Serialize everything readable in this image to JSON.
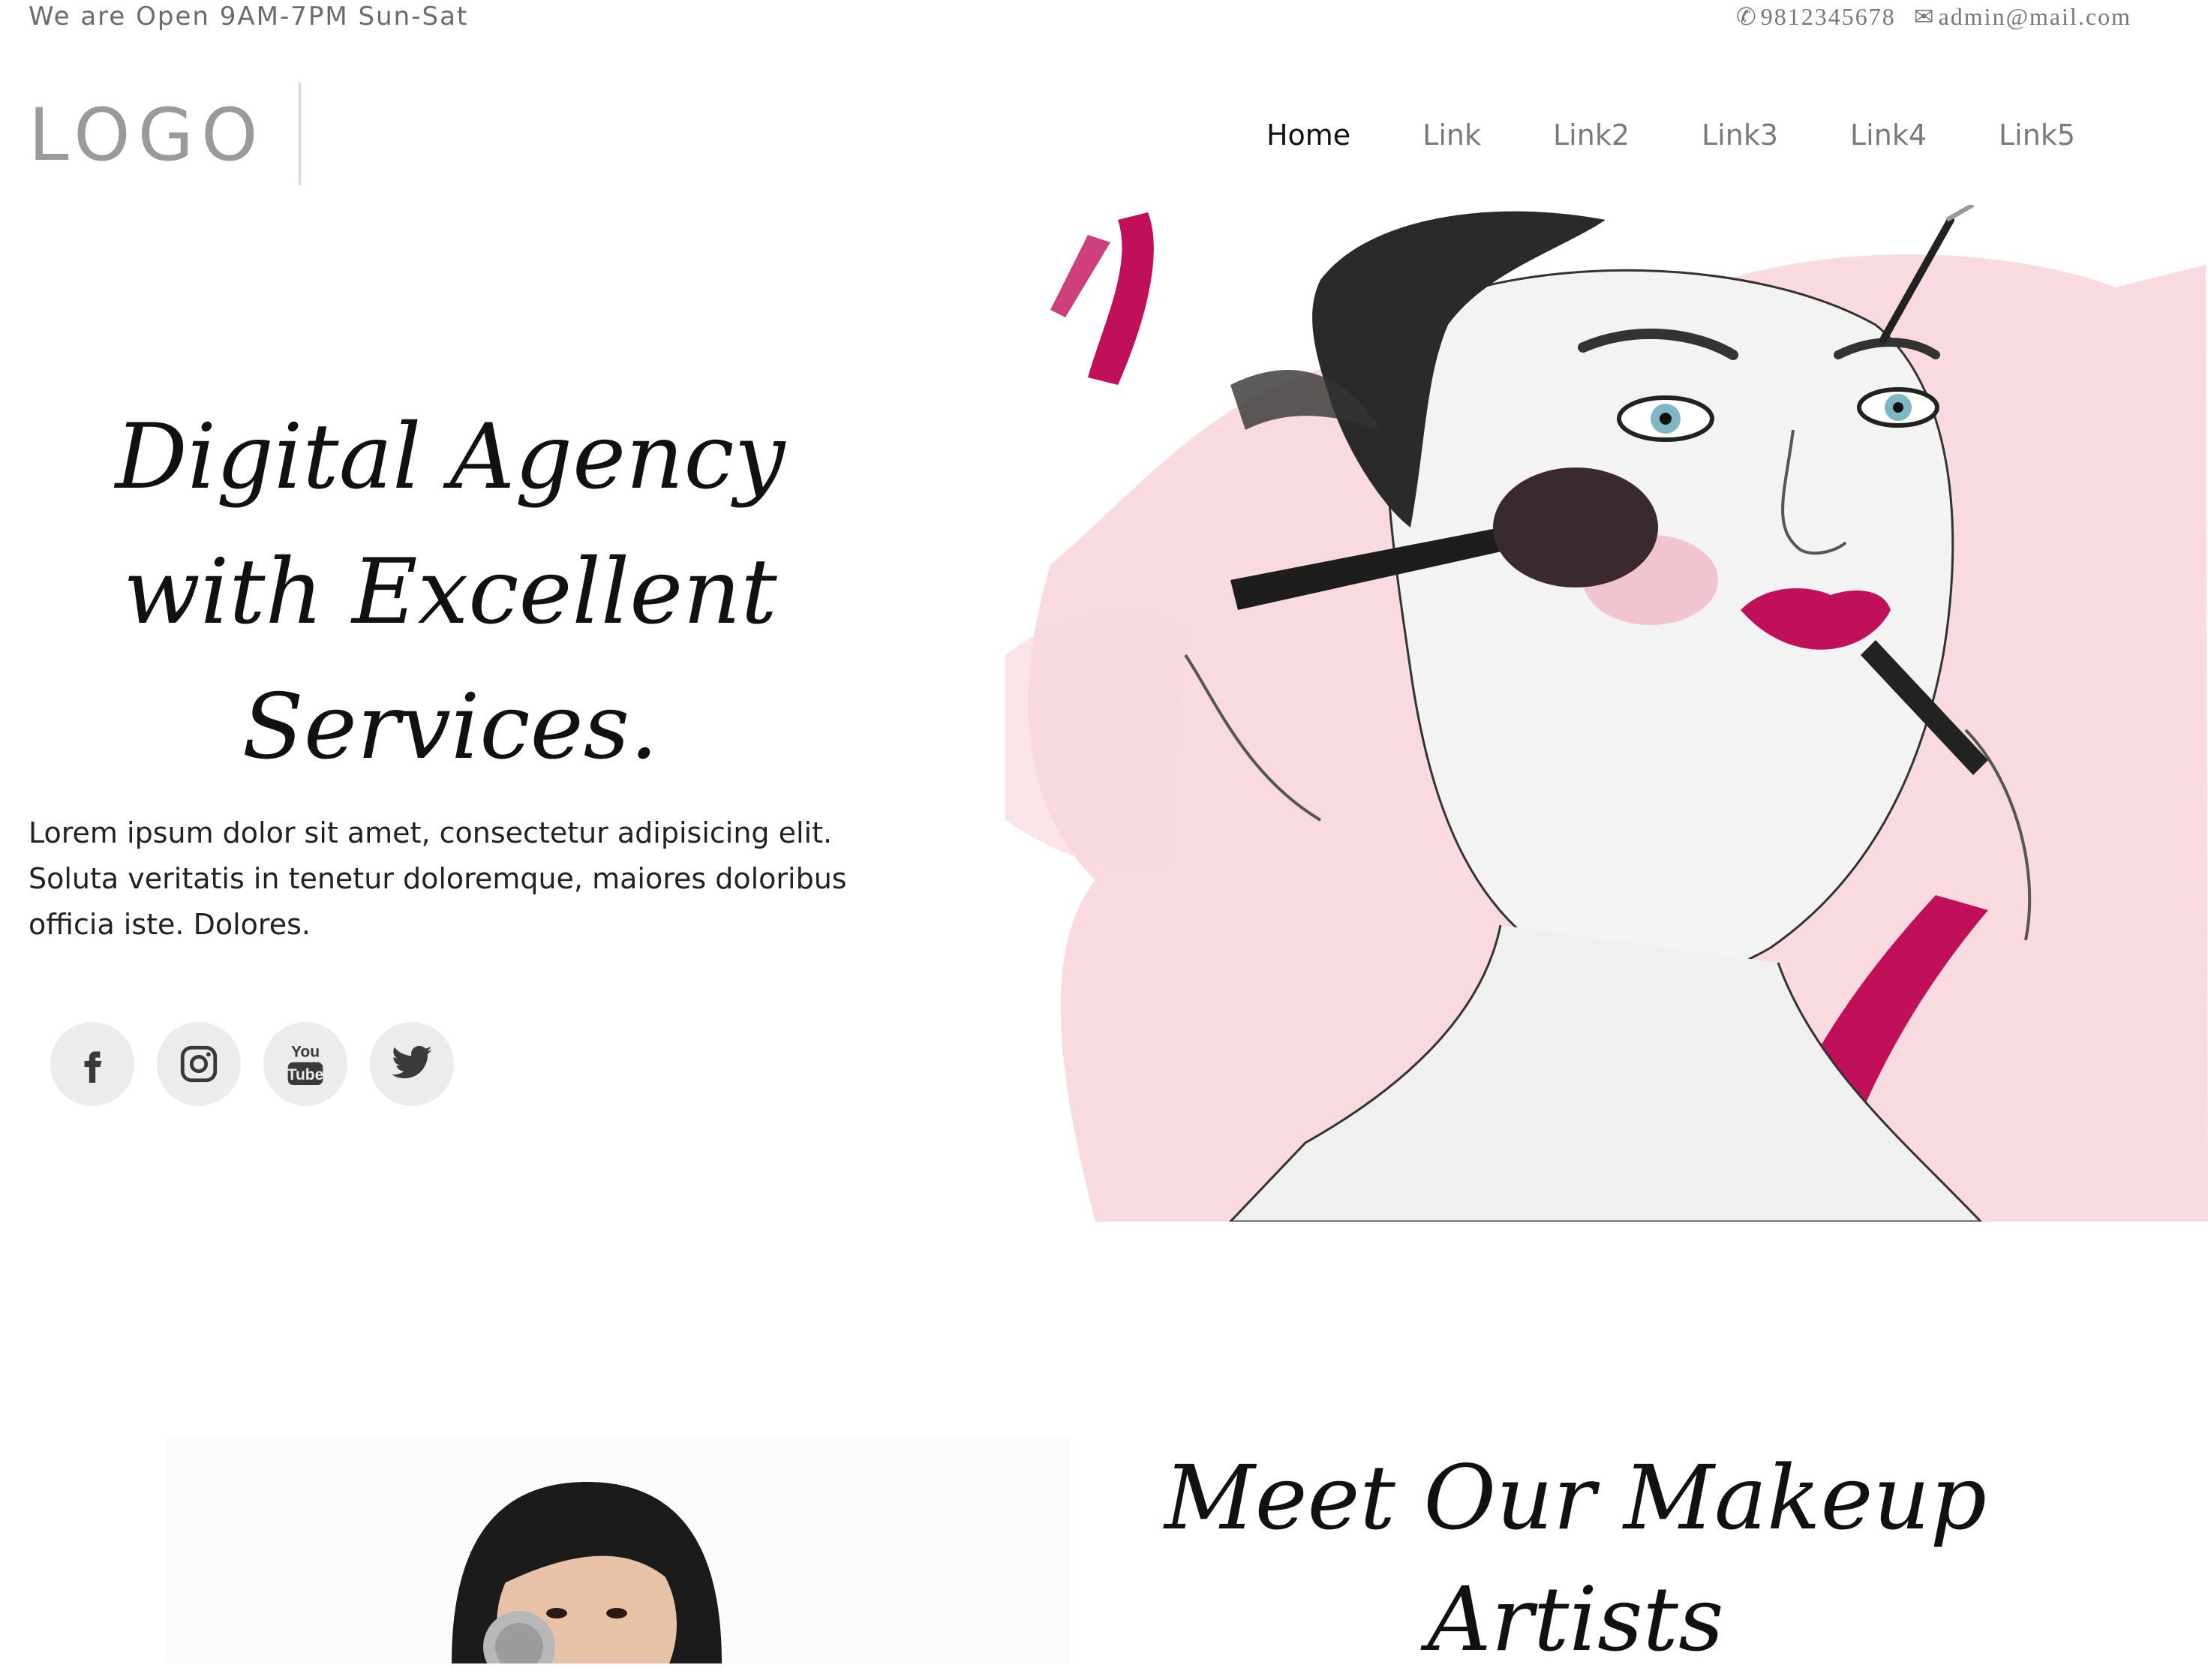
{
  "topbar": {
    "hours": "We are Open 9AM-7PM Sun-Sat",
    "phone": "9812345678",
    "email": "admin@mail.com"
  },
  "header": {
    "logo": "LOGO",
    "nav": [
      {
        "label": "Home",
        "active": true
      },
      {
        "label": "Link",
        "active": false
      },
      {
        "label": "Link2",
        "active": false
      },
      {
        "label": "Link3",
        "active": false
      },
      {
        "label": "Link4",
        "active": false
      },
      {
        "label": "Link5",
        "active": false
      }
    ]
  },
  "hero": {
    "title_line1": "Digital Agency",
    "title_line2": "with Excellent",
    "title_line3": "Services.",
    "text": "Lorem ipsum dolor sit amet, consectetur adipisicing elit. Soluta veritatis in tenetur doloremque, maiores doloribus officia iste. Dolores.",
    "social": [
      "facebook-icon",
      "instagram-icon",
      "youtube-icon",
      "twitter-icon"
    ]
  },
  "section2": {
    "title_line1": "Meet Our Makeup",
    "title_line2": "Artists"
  },
  "colors": {
    "accent": "#c0105a",
    "pink_wash": "#f5c8d0",
    "social_bg": "#ececec"
  }
}
